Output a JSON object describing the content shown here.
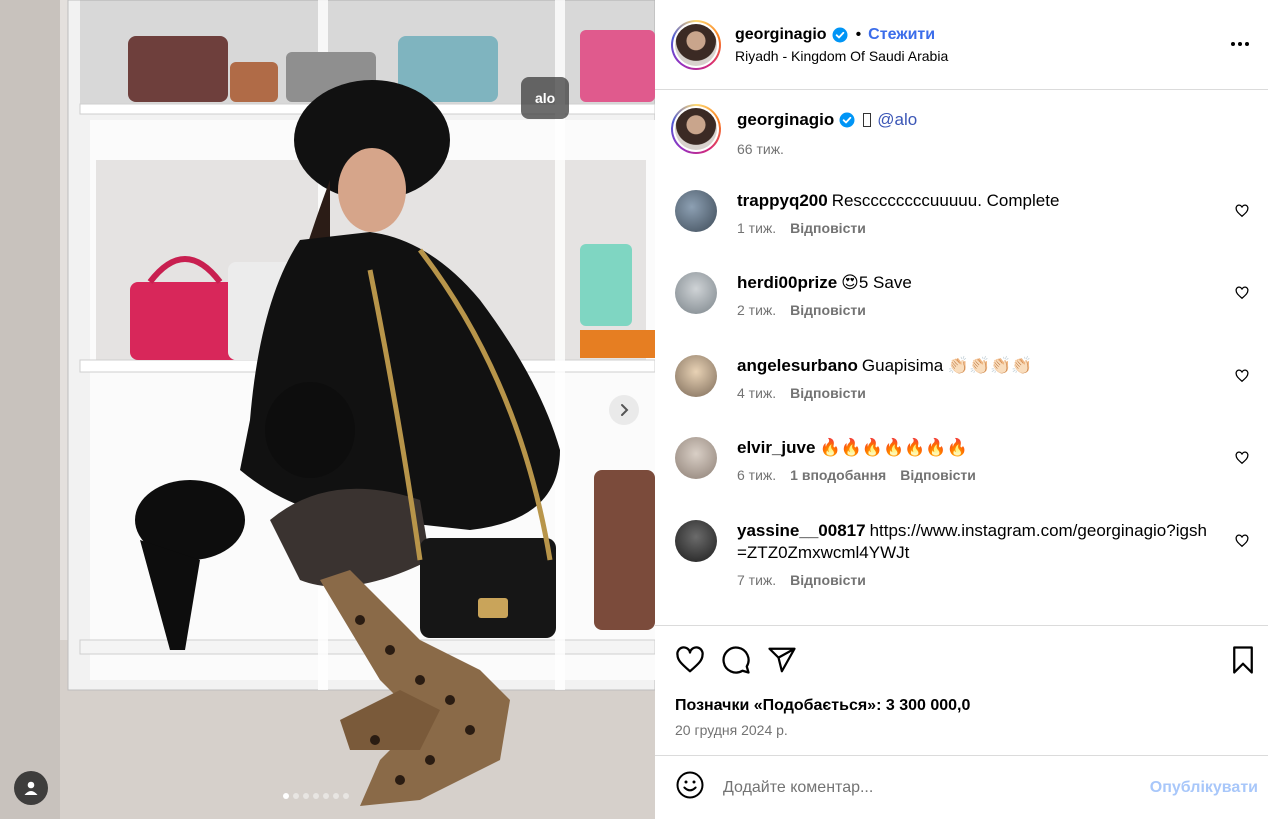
{
  "post": {
    "tag_label": "alo",
    "carousel": {
      "total": 7,
      "active_index": 0
    }
  },
  "header": {
    "username": "georginagio",
    "separator": "•",
    "follow_label": "Стежити",
    "location": "Riyadh - Kingdom Of Saudi Arabia"
  },
  "caption": {
    "username": "georginagio",
    "mention": "@alo",
    "time": "66 тиж."
  },
  "comments": [
    {
      "user": "trappyq200",
      "text": "Resccccccccuuuuu. Complete",
      "time": "1 тиж.",
      "likes": "",
      "reply": "Відповісти"
    },
    {
      "user": "herdi00prize",
      "text": "😍5 Save",
      "time": "2 тиж.",
      "likes": "",
      "reply": "Відповісти"
    },
    {
      "user": "angelesurbano",
      "text": "Guapisima 👏🏻👏🏻👏🏻👏🏻",
      "time": "4 тиж.",
      "likes": "",
      "reply": "Відповісти"
    },
    {
      "user": "elvir_juve",
      "text": "🔥🔥🔥🔥🔥🔥🔥",
      "time": "6 тиж.",
      "likes": "1 вподобання",
      "reply": "Відповісти"
    },
    {
      "user": "yassine__00817",
      "text": "https://www.instagram.com/georginagio?igsh=ZTZ0Zmxwcml4YWJt",
      "time": "7 тиж.",
      "likes": "",
      "reply": "Відповісти"
    }
  ],
  "footer": {
    "likes_text": "Позначки «Подобається»: 3 300 000,0",
    "date": "20 грудня 2024 р.",
    "comment_placeholder": "Додайте коментар...",
    "post_label": "Опублікувати"
  },
  "colors": {
    "accent": "#3b6dea",
    "verified": "#0095f6",
    "post_disabled": "#a8c7fa",
    "meta": "#737373",
    "divider": "#dbdbdb"
  },
  "icons": [
    "verified-icon",
    "more-icon",
    "heart-icon",
    "comment-icon",
    "share-icon",
    "bookmark-icon",
    "emoji-icon",
    "chevron-right-icon",
    "user-tag-icon"
  ]
}
